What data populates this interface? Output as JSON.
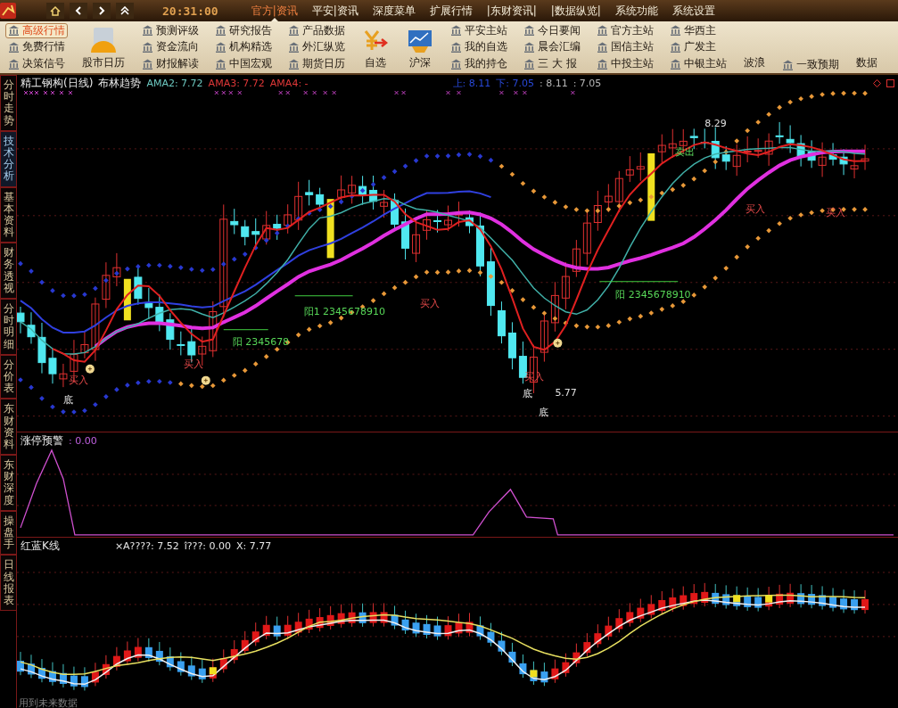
{
  "top_bar": {
    "clock": "20:31:00",
    "menu": [
      {
        "label": "官方|资讯",
        "selected": true
      },
      {
        "label": "平安|资讯",
        "selected": false
      },
      {
        "label": "深度菜单",
        "selected": false
      },
      {
        "label": "扩展行情",
        "selected": false
      },
      {
        "label": "|东财资讯|",
        "selected": false
      },
      {
        "label": "|数据纵览|",
        "selected": false
      },
      {
        "label": "系统功能",
        "selected": false
      },
      {
        "label": "系统设置",
        "selected": false
      }
    ]
  },
  "toolbar": [
    {
      "kind": "column",
      "items": [
        {
          "label": "高级行情",
          "selected": true
        },
        {
          "label": "免费行情",
          "selected": false
        },
        {
          "label": "决策信号",
          "selected": false
        }
      ]
    },
    {
      "kind": "calendar",
      "label": "股市日历"
    },
    {
      "kind": "column",
      "items": [
        {
          "label": "预测评级",
          "selected": false
        },
        {
          "label": "资金流向",
          "selected": false
        },
        {
          "label": "财报解读",
          "selected": false
        }
      ]
    },
    {
      "kind": "column",
      "items": [
        {
          "label": "研究报告",
          "selected": false
        },
        {
          "label": "机构精选",
          "selected": false
        },
        {
          "label": "中国宏观",
          "selected": false
        }
      ]
    },
    {
      "kind": "column",
      "items": [
        {
          "label": "产品数据",
          "selected": false
        },
        {
          "label": "外汇纵览",
          "selected": false
        },
        {
          "label": "期货日历",
          "selected": false
        }
      ]
    },
    {
      "kind": "watchlist",
      "label": "自选"
    },
    {
      "kind": "market",
      "label": "沪深"
    },
    {
      "kind": "column",
      "items": [
        {
          "label": "平安主站",
          "selected": false
        },
        {
          "label": "我的自选",
          "selected": false
        },
        {
          "label": "我的持仓",
          "selected": false
        }
      ]
    },
    {
      "kind": "column",
      "items": [
        {
          "label": "今日要闻",
          "selected": false
        },
        {
          "label": "晨会汇编",
          "selected": false
        },
        {
          "label": "三 大 报",
          "selected": false
        }
      ]
    },
    {
      "kind": "column",
      "items": [
        {
          "label": "官方主站",
          "selected": false
        },
        {
          "label": "国信主站",
          "selected": false
        },
        {
          "label": "中投主站",
          "selected": false
        }
      ]
    },
    {
      "kind": "column",
      "items": [
        {
          "label": "华西主",
          "selected": false
        },
        {
          "label": "广发主",
          "selected": false
        },
        {
          "label": "中银主站",
          "selected": false
        }
      ]
    },
    {
      "kind": "plain",
      "label": "波浪"
    },
    {
      "kind": "column",
      "items": [
        {
          "label": "一致预期",
          "selected": false
        }
      ]
    },
    {
      "kind": "plain",
      "label": "数据"
    }
  ],
  "side_tabs": [
    {
      "label": "分时走势",
      "selected": false
    },
    {
      "label": "技术分析",
      "selected": true
    },
    {
      "label": "基本资料",
      "selected": false
    },
    {
      "label": "财务透视",
      "selected": false
    },
    {
      "label": "分时明细",
      "selected": false
    },
    {
      "label": "分价表",
      "selected": false
    },
    {
      "label": "东财资料",
      "selected": false
    },
    {
      "label": "东财深度",
      "selected": false
    },
    {
      "label": "操盘手",
      "selected": false
    },
    {
      "label": "日线报表",
      "selected": false
    }
  ],
  "main_chart": {
    "title": "精工钢构(日线)",
    "indicator": "布林趋势",
    "values": [
      {
        "text": "AMA2: 7.72",
        "color": "#6cc8c0"
      },
      {
        "text": "AMA3: 7.72",
        "color": "#e03838"
      },
      {
        "text": "AMA4: -",
        "color": "#e03838"
      }
    ],
    "bands": [
      {
        "text": "上: 8.11",
        "color": "#2848d8"
      },
      {
        "text": "下: 7.05",
        "color": "#2848d8"
      },
      {
        "text": ": 8.11",
        "color": "#b8b8b8"
      },
      {
        "text": ": 7.05",
        "color": "#b8b8b8"
      }
    ],
    "annotations": [
      {
        "kind": "buy",
        "text": "买入"
      },
      {
        "kind": "buy",
        "text": "买入"
      },
      {
        "kind": "buy",
        "text": "买入"
      },
      {
        "kind": "buy",
        "text": "买入"
      },
      {
        "kind": "buy",
        "text": "买入"
      },
      {
        "kind": "buy",
        "text": "买入"
      },
      {
        "kind": "bottom",
        "text": "底"
      },
      {
        "kind": "bottom",
        "text": "底"
      },
      {
        "kind": "bottom",
        "text": "底"
      },
      {
        "kind": "sell",
        "text": "卖出"
      },
      {
        "kind": "price",
        "text": "8.29"
      },
      {
        "kind": "price",
        "text": "5.77"
      },
      {
        "kind": "count",
        "text": "阳1 2345678910"
      },
      {
        "kind": "count",
        "text": "阳 2345678"
      },
      {
        "kind": "count",
        "text": "阳 2345678910"
      }
    ]
  },
  "alert_chart": {
    "title": "涨停预警",
    "value": ": 0.00"
  },
  "kline_chart": {
    "title": "红蓝K线",
    "values": [
      "×A????: 7.52",
      "î???: 0.00",
      "X: 7.77"
    ],
    "footer": "用到未来数据"
  }
}
